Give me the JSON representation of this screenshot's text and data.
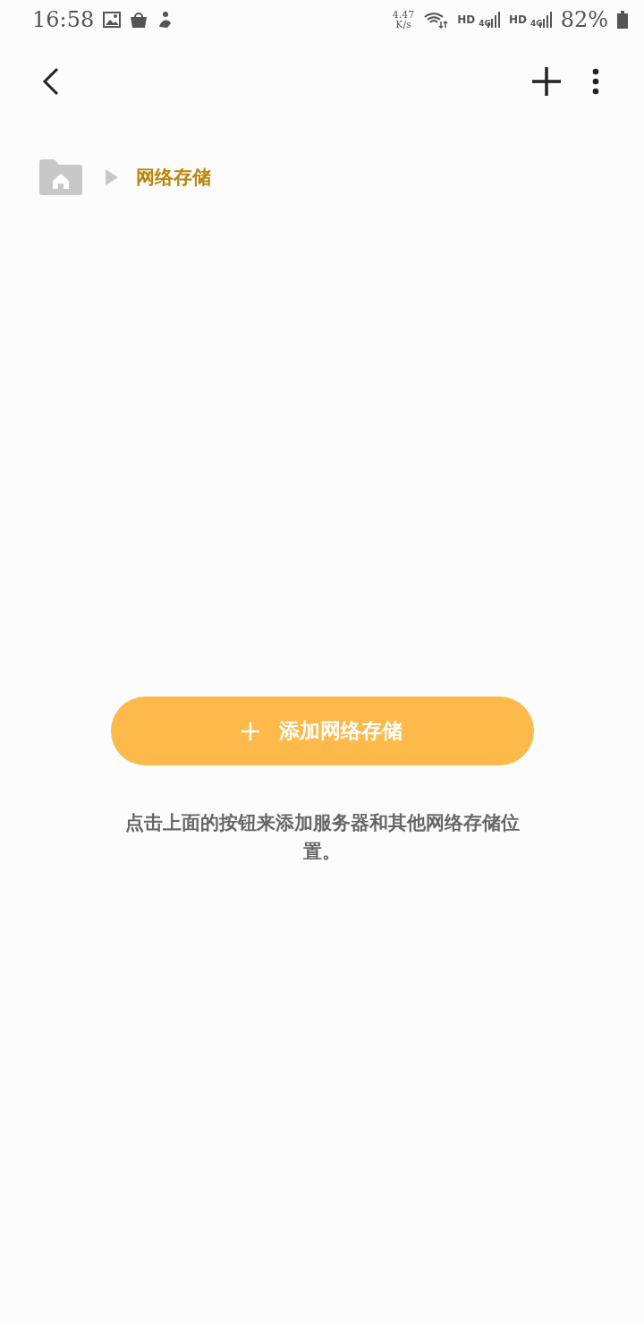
{
  "status_bar": {
    "time": "16:58",
    "net_speed": "4.47",
    "net_speed_unit": "K/s",
    "sims": [
      {
        "hd": "HD",
        "network": "4G"
      },
      {
        "hd": "HD",
        "network": "4G"
      }
    ],
    "battery": "82%"
  },
  "breadcrumb": {
    "items": [
      {
        "kind": "home"
      },
      {
        "kind": "folder",
        "label": "网络存储"
      }
    ]
  },
  "add_button": {
    "label": "添加网络存储"
  },
  "hint": "点击上面的按钮来添加服务器和其他网络存储位置。"
}
